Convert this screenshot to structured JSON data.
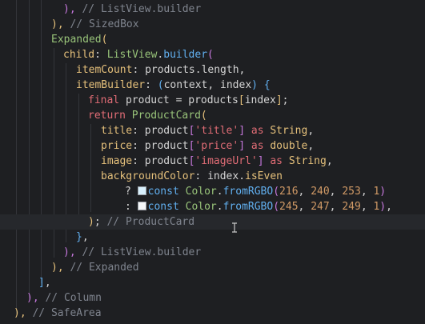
{
  "editor": {
    "lines": [
      {
        "id": "l1",
        "tokens": [
          {
            "t": "), ",
            "c": "tok-paren2"
          },
          {
            "t": "// ListView.builder",
            "c": "tok-comment"
          }
        ]
      },
      {
        "id": "l2",
        "tokens": [
          {
            "t": "), ",
            "c": "tok-paren1"
          },
          {
            "t": "// SizedBox",
            "c": "tok-comment"
          }
        ]
      },
      {
        "id": "l3",
        "tokens": [
          {
            "t": "Expanded",
            "c": "tok-class"
          },
          {
            "t": "(",
            "c": "tok-paren1"
          }
        ]
      },
      {
        "id": "l4",
        "tokens": [
          {
            "t": "child",
            "c": "tok-prop"
          },
          {
            "t": ": ",
            "c": "tok-op"
          },
          {
            "t": "ListView",
            "c": "tok-class"
          },
          {
            "t": ".",
            "c": "tok-op"
          },
          {
            "t": "builder",
            "c": "tok-method"
          },
          {
            "t": "(",
            "c": "tok-paren2"
          }
        ]
      },
      {
        "id": "l5",
        "tokens": [
          {
            "t": "itemCount",
            "c": "tok-prop"
          },
          {
            "t": ": ",
            "c": "tok-op"
          },
          {
            "t": "products",
            "c": "tok-plain"
          },
          {
            "t": ".",
            "c": "tok-op"
          },
          {
            "t": "length",
            "c": "tok-plain"
          },
          {
            "t": ",",
            "c": "tok-op"
          }
        ]
      },
      {
        "id": "l6",
        "tokens": [
          {
            "t": "itemBuilder",
            "c": "tok-prop"
          },
          {
            "t": ": ",
            "c": "tok-op"
          },
          {
            "t": "(",
            "c": "tok-paren4"
          },
          {
            "t": "context",
            "c": "tok-plain"
          },
          {
            "t": ", ",
            "c": "tok-op"
          },
          {
            "t": "index",
            "c": "tok-plain"
          },
          {
            "t": ") ",
            "c": "tok-paren4"
          },
          {
            "t": "{",
            "c": "tok-paren4"
          }
        ]
      },
      {
        "id": "l7",
        "tokens": [
          {
            "t": "final ",
            "c": "tok-keyword"
          },
          {
            "t": "product",
            "c": "tok-plain"
          },
          {
            "t": " = ",
            "c": "tok-op"
          },
          {
            "t": "products",
            "c": "tok-plain"
          },
          {
            "t": "[",
            "c": "tok-paren1"
          },
          {
            "t": "index",
            "c": "tok-plain"
          },
          {
            "t": "]",
            "c": "tok-paren1"
          },
          {
            "t": ";",
            "c": "tok-op"
          }
        ]
      },
      {
        "id": "l8",
        "tokens": [
          {
            "t": "return ",
            "c": "tok-keyword"
          },
          {
            "t": "ProductCard",
            "c": "tok-class"
          },
          {
            "t": "(",
            "c": "tok-paren1"
          }
        ]
      },
      {
        "id": "l9",
        "tokens": [
          {
            "t": "title",
            "c": "tok-prop"
          },
          {
            "t": ": ",
            "c": "tok-op"
          },
          {
            "t": "product",
            "c": "tok-plain"
          },
          {
            "t": "[",
            "c": "tok-paren2"
          },
          {
            "t": "'title'",
            "c": "tok-string"
          },
          {
            "t": "]",
            "c": "tok-paren2"
          },
          {
            "t": " as ",
            "c": "tok-keyword"
          },
          {
            "t": "String",
            "c": "tok-type"
          },
          {
            "t": ",",
            "c": "tok-op"
          }
        ]
      },
      {
        "id": "l10",
        "tokens": [
          {
            "t": "price",
            "c": "tok-prop"
          },
          {
            "t": ": ",
            "c": "tok-op"
          },
          {
            "t": "product",
            "c": "tok-plain"
          },
          {
            "t": "[",
            "c": "tok-paren2"
          },
          {
            "t": "'price'",
            "c": "tok-string"
          },
          {
            "t": "]",
            "c": "tok-paren2"
          },
          {
            "t": " as ",
            "c": "tok-keyword"
          },
          {
            "t": "double",
            "c": "tok-type"
          },
          {
            "t": ",",
            "c": "tok-op"
          }
        ]
      },
      {
        "id": "l11",
        "tokens": [
          {
            "t": "image",
            "c": "tok-prop"
          },
          {
            "t": ": ",
            "c": "tok-op"
          },
          {
            "t": "product",
            "c": "tok-plain"
          },
          {
            "t": "[",
            "c": "tok-paren2"
          },
          {
            "t": "'imageUrl'",
            "c": "tok-string"
          },
          {
            "t": "]",
            "c": "tok-paren2"
          },
          {
            "t": " as ",
            "c": "tok-keyword"
          },
          {
            "t": "String",
            "c": "tok-type"
          },
          {
            "t": ",",
            "c": "tok-op"
          }
        ]
      },
      {
        "id": "l12",
        "tokens": [
          {
            "t": "backgroundColor",
            "c": "tok-prop"
          },
          {
            "t": ": ",
            "c": "tok-op"
          },
          {
            "t": "index",
            "c": "tok-plain"
          },
          {
            "t": ".",
            "c": "tok-op"
          },
          {
            "t": "isEven",
            "c": "tok-prop"
          }
        ]
      },
      {
        "id": "l13",
        "swatch": "#d8f0fd",
        "tokens": [
          {
            "t": "? ",
            "c": "tok-op"
          },
          {
            "t": "",
            "c": "swatch"
          },
          {
            "t": "const ",
            "c": "tok-method"
          },
          {
            "t": "Color",
            "c": "tok-class"
          },
          {
            "t": ".",
            "c": "tok-op"
          },
          {
            "t": "fromRGBO",
            "c": "tok-method"
          },
          {
            "t": "(",
            "c": "tok-paren2"
          },
          {
            "t": "216",
            "c": "tok-number"
          },
          {
            "t": ", ",
            "c": "tok-op"
          },
          {
            "t": "240",
            "c": "tok-number"
          },
          {
            "t": ", ",
            "c": "tok-op"
          },
          {
            "t": "253",
            "c": "tok-number"
          },
          {
            "t": ", ",
            "c": "tok-op"
          },
          {
            "t": "1",
            "c": "tok-number"
          },
          {
            "t": ")",
            "c": "tok-paren2"
          }
        ]
      },
      {
        "id": "l14",
        "swatch": "#f5f7f9",
        "tokens": [
          {
            "t": ": ",
            "c": "tok-op"
          },
          {
            "t": "",
            "c": "swatch"
          },
          {
            "t": "const ",
            "c": "tok-method"
          },
          {
            "t": "Color",
            "c": "tok-class"
          },
          {
            "t": ".",
            "c": "tok-op"
          },
          {
            "t": "fromRGBO",
            "c": "tok-method"
          },
          {
            "t": "(",
            "c": "tok-paren2"
          },
          {
            "t": "245",
            "c": "tok-number"
          },
          {
            "t": ", ",
            "c": "tok-op"
          },
          {
            "t": "247",
            "c": "tok-number"
          },
          {
            "t": ", ",
            "c": "tok-op"
          },
          {
            "t": "249",
            "c": "tok-number"
          },
          {
            "t": ", ",
            "c": "tok-op"
          },
          {
            "t": "1",
            "c": "tok-number"
          },
          {
            "t": ")",
            "c": "tok-paren2"
          },
          {
            "t": ",",
            "c": "tok-op"
          }
        ]
      },
      {
        "id": "l15",
        "active": true,
        "tokens": [
          {
            "t": ")",
            "c": "tok-paren1"
          },
          {
            "t": "; ",
            "c": "tok-op"
          },
          {
            "t": "// ProductCard",
            "c": "tok-comment"
          }
        ]
      },
      {
        "id": "l16",
        "tokens": [
          {
            "t": "}",
            "c": "tok-paren4"
          },
          {
            "t": ",",
            "c": "tok-op"
          }
        ]
      },
      {
        "id": "l17",
        "tokens": [
          {
            "t": "), ",
            "c": "tok-paren2"
          },
          {
            "t": "// ListView.builder",
            "c": "tok-comment"
          }
        ]
      },
      {
        "id": "l18",
        "tokens": [
          {
            "t": "), ",
            "c": "tok-paren1"
          },
          {
            "t": "// Expanded",
            "c": "tok-comment"
          }
        ]
      },
      {
        "id": "l19",
        "tokens": [
          {
            "t": "]",
            "c": "tok-bracket-outer"
          },
          {
            "t": ",",
            "c": "tok-op"
          }
        ]
      },
      {
        "id": "l20",
        "tokens": [
          {
            "t": "), ",
            "c": "tok-paren2"
          },
          {
            "t": "// Column",
            "c": "tok-comment"
          }
        ]
      },
      {
        "id": "l21",
        "tokens": [
          {
            "t": "), ",
            "c": "tok-paren1"
          },
          {
            "t": "// SafeArea",
            "c": "tok-comment"
          }
        ]
      }
    ]
  }
}
